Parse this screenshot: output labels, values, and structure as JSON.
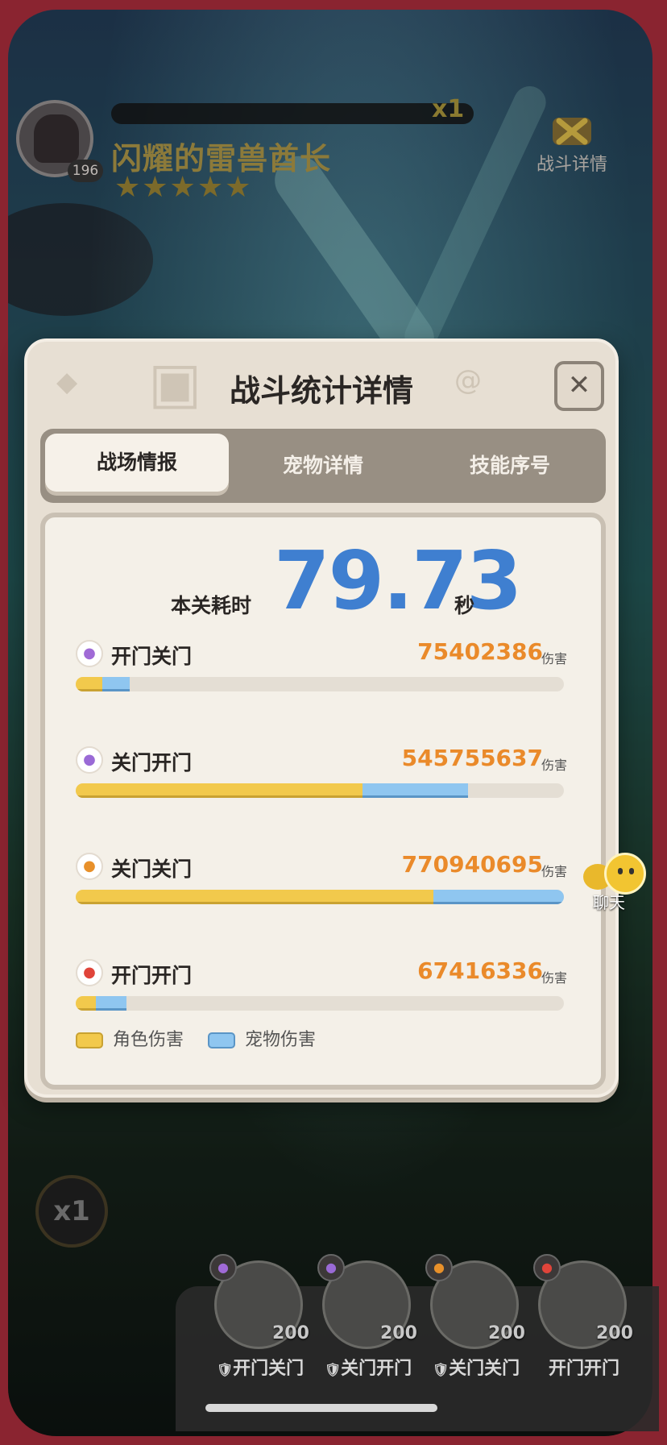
{
  "boss": {
    "name": "闪耀的雷兽酋长",
    "level": "196",
    "hp_multiplier": "x1",
    "stars": "★★★★★",
    "star_count": 5
  },
  "battle_detail_button": {
    "label": "战斗详情"
  },
  "modal": {
    "title": "战斗统计详情",
    "close_label": "✕",
    "tabs": [
      {
        "label": "战场情报",
        "active": true
      },
      {
        "label": "宠物详情",
        "active": false
      },
      {
        "label": "技能序号",
        "active": false
      }
    ],
    "time": {
      "label": "本关耗时",
      "value": "79.73",
      "unit": "秒"
    },
    "rows": [
      {
        "name": "开门关门",
        "value": "75402386",
        "unit": "伤害",
        "icon": "purple-swirl-icon",
        "icon_color": "#a06ad6",
        "role_frac": 0.055,
        "pet_frac": 0.055
      },
      {
        "name": "关门开门",
        "value": "545755637",
        "unit": "伤害",
        "icon": "violet-vortex-icon",
        "icon_color": "#9a6ad6",
        "role_frac": 0.587,
        "pet_frac": 0.217
      },
      {
        "name": "关门关门",
        "value": "770940695",
        "unit": "伤害",
        "icon": "orange-blade-icon",
        "icon_color": "#e8902a",
        "role_frac": 0.732,
        "pet_frac": 0.268
      },
      {
        "name": "开门开门",
        "value": "67416336",
        "unit": "伤害",
        "icon": "red-flame-icon",
        "icon_color": "#e0443a",
        "role_frac": 0.042,
        "pet_frac": 0.062
      }
    ],
    "legend": [
      {
        "label": "角色伤害",
        "color": "#f2c94c"
      },
      {
        "label": "宠物伤害",
        "color": "#8fc6f0"
      }
    ]
  },
  "chat": {
    "label": "聊天"
  },
  "speed": {
    "label": "x1"
  },
  "team": [
    {
      "name": "开门关门",
      "level": "200",
      "element_color": "#a06ad6",
      "badge": "🛡"
    },
    {
      "name": "关门开门",
      "level": "200",
      "element_color": "#9a6ad6",
      "badge": "🛡"
    },
    {
      "name": "关门关门",
      "level": "200",
      "element_color": "#e8902a",
      "badge": "🛡"
    },
    {
      "name": "开门开门",
      "level": "200",
      "element_color": "#e0443a",
      "badge": ""
    }
  ]
}
